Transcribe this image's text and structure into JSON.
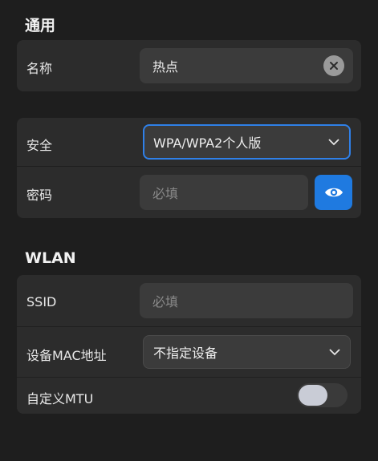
{
  "general": {
    "title": "通用",
    "name_label": "名称",
    "name_value": "热点"
  },
  "security": {
    "security_label": "安全",
    "security_value": "WPA/WPA2个人版",
    "password_label": "密码",
    "password_placeholder": "必填"
  },
  "wlan": {
    "title": "WLAN",
    "ssid_label": "SSID",
    "ssid_placeholder": "必填",
    "mac_label": "设备MAC地址",
    "mac_value": "不指定设备",
    "mtu_label": "自定义MTU",
    "mtu_enabled": false
  },
  "colors": {
    "accent": "#1f7ae0",
    "background": "#1e1e1e",
    "card": "#2c2c2c"
  }
}
